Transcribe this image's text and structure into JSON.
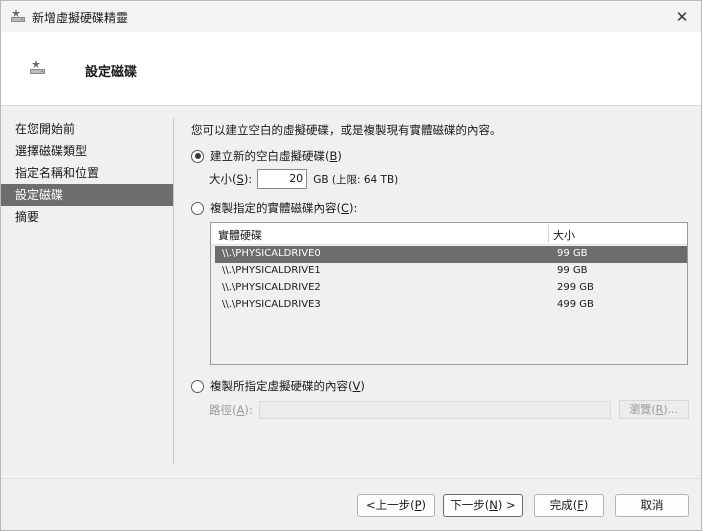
{
  "window": {
    "title": "新增虛擬硬碟精靈",
    "close_glyph": "✕"
  },
  "header": {
    "title": "設定磁碟"
  },
  "nav": {
    "items": [
      {
        "label": "在您開始前",
        "active": false
      },
      {
        "label": "選擇磁碟類型",
        "active": false
      },
      {
        "label": "指定名稱和位置",
        "active": false
      },
      {
        "label": "設定磁碟",
        "active": true
      },
      {
        "label": "摘要",
        "active": false
      }
    ]
  },
  "main": {
    "intro": "您可以建立空白的虛擬硬碟，或是複製現有實體磁碟的內容。",
    "option_new": {
      "label": "建立新的空白虛擬硬碟",
      "key": "B",
      "checked": true
    },
    "size": {
      "label": "大小",
      "key": "S",
      "value": "20",
      "unit_text": "GB (上限: 64 TB)"
    },
    "option_copy_physical": {
      "label": "複製指定的實體磁碟內容",
      "key": "C",
      "checked": false
    },
    "disk_table": {
      "headers": [
        "實體硬碟",
        "大小"
      ],
      "rows": [
        {
          "name": "\\\\.\\PHYSICALDRIVE0",
          "size": "99 GB",
          "selected": true
        },
        {
          "name": "\\\\.\\PHYSICALDRIVE1",
          "size": "99 GB",
          "selected": false
        },
        {
          "name": "\\\\.\\PHYSICALDRIVE2",
          "size": "299 GB",
          "selected": false
        },
        {
          "name": "\\\\.\\PHYSICALDRIVE3",
          "size": "499 GB",
          "selected": false
        }
      ]
    },
    "option_copy_virtual": {
      "label": "複製所指定虛擬硬碟的內容",
      "key": "V",
      "checked": false
    },
    "path": {
      "label": "路徑",
      "key": "A",
      "value": ""
    },
    "browse": {
      "label": "瀏覽",
      "key": "R",
      "suffix": "..."
    }
  },
  "footer": {
    "prev": {
      "label": "<上一步",
      "key": "P"
    },
    "next": {
      "label": "下一步",
      "key": "N",
      "suffix": " >"
    },
    "finish": {
      "label": "完成",
      "key": "F"
    },
    "cancel": {
      "label": "取消"
    }
  },
  "colors": {
    "selection": "#6d6d6d",
    "header_bg": "#ffffff",
    "window_bg": "#f0f0f0"
  },
  "icons": {
    "title": "disk-wizard-icon",
    "header": "disk-wizard-icon",
    "close": "close-icon"
  }
}
